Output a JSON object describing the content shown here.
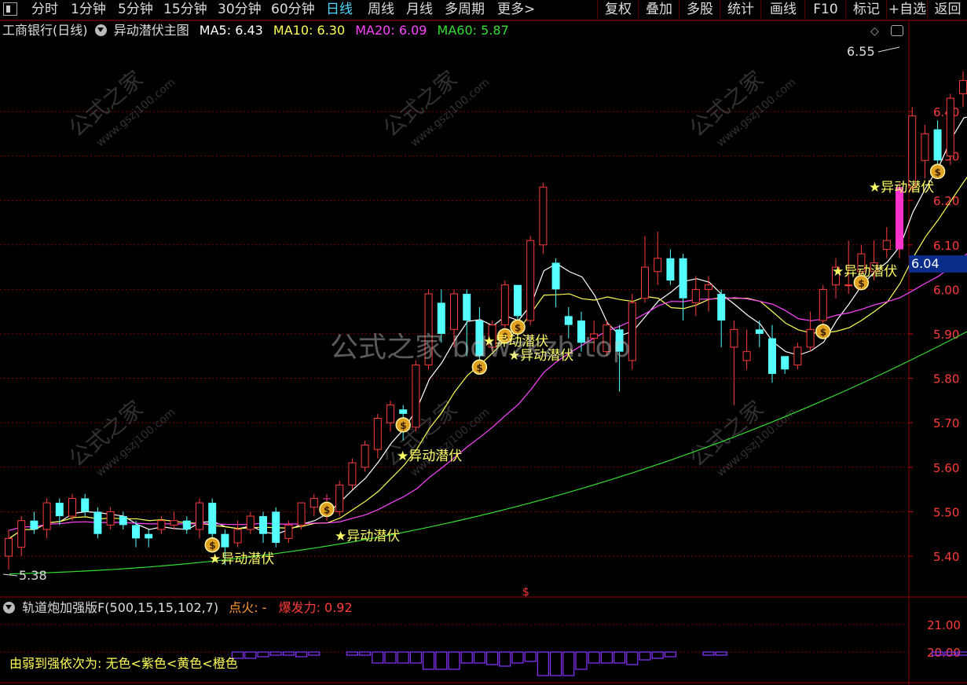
{
  "toolbar": {
    "periods": [
      "分时",
      "1分钟",
      "5分钟",
      "15分钟",
      "30分钟",
      "60分钟",
      "日线",
      "周线",
      "月线",
      "多周期",
      "更多>"
    ],
    "active_period": "日线",
    "right_buttons": [
      "复权",
      "叠加",
      "多股",
      "统计",
      "画线",
      "F10",
      "标记",
      "+自选",
      "返回"
    ]
  },
  "info": {
    "stock": "工商银行(日线)",
    "indicator": "异动潜伏主图",
    "ma5": "MA5: 6.43",
    "ma10": "MA10: 6.30",
    "ma20": "MA20: 6.09",
    "ma60": "MA60: 5.87"
  },
  "sub": {
    "indicator": "轨道炮加强版F(500,15,15,102,7)",
    "fire": "点火: -",
    "burst": "爆发力: 0.92",
    "legend": "由弱到强依次为: 无色<紫色<黄色<橙色"
  },
  "annotations": {
    "high_label": "6.55",
    "low_label": "5.38",
    "signal_text": "异动潜伏",
    "current_price": "6.04",
    "watermark": "公式之家",
    "watermark_url": "www.gszj100.com",
    "center_watermark": "公式之家 bdwzkzh.top"
  },
  "colors": {
    "up": "#ff3b3b",
    "down": "#54ffff",
    "ma5": "#ffffff",
    "ma10": "#ffff55",
    "ma20": "#ff44ff",
    "ma60": "#33dd33",
    "grid": "#7a0000",
    "signal_bar": "#ff33cc",
    "volume": "#8833ff"
  },
  "chart_data": {
    "type": "candlestick",
    "y_axis_ticks": [
      5.4,
      5.5,
      5.6,
      5.7,
      5.8,
      5.9,
      6.0,
      6.1,
      6.2,
      6.3,
      6.4
    ],
    "sub_axis_ticks": [
      20.0,
      21.0
    ],
    "candles": [
      [
        5.4,
        5.44,
        5.37,
        5.46
      ],
      [
        5.42,
        5.48,
        5.4,
        5.49
      ],
      [
        5.48,
        5.46,
        5.45,
        5.5
      ],
      [
        5.46,
        5.52,
        5.44,
        5.53
      ],
      [
        5.52,
        5.49,
        5.47,
        5.53
      ],
      [
        5.49,
        5.53,
        5.48,
        5.54
      ],
      [
        5.53,
        5.5,
        5.49,
        5.54
      ],
      [
        5.5,
        5.45,
        5.44,
        5.51
      ],
      [
        5.47,
        5.5,
        5.46,
        5.51
      ],
      [
        5.49,
        5.47,
        5.46,
        5.5
      ],
      [
        5.47,
        5.44,
        5.42,
        5.48
      ],
      [
        5.45,
        5.44,
        5.42,
        5.46
      ],
      [
        5.46,
        5.48,
        5.45,
        5.49
      ],
      [
        5.47,
        5.48,
        5.46,
        5.5
      ],
      [
        5.48,
        5.46,
        5.45,
        5.49
      ],
      [
        5.46,
        5.52,
        5.44,
        5.53
      ],
      [
        5.52,
        5.45,
        5.44,
        5.53
      ],
      [
        5.45,
        5.42,
        5.38,
        5.46
      ],
      [
        5.43,
        5.46,
        5.42,
        5.48
      ],
      [
        5.46,
        5.49,
        5.45,
        5.5
      ],
      [
        5.49,
        5.45,
        5.43,
        5.5
      ],
      [
        5.5,
        5.43,
        5.42,
        5.51
      ],
      [
        5.44,
        5.47,
        5.43,
        5.48
      ],
      [
        5.47,
        5.52,
        5.46,
        5.52
      ],
      [
        5.51,
        5.53,
        5.49,
        5.54
      ],
      [
        5.53,
        5.53,
        5.48,
        5.54
      ],
      [
        5.5,
        5.56,
        5.49,
        5.57
      ],
      [
        5.56,
        5.61,
        5.55,
        5.62
      ],
      [
        5.6,
        5.65,
        5.59,
        5.66
      ],
      [
        5.64,
        5.71,
        5.62,
        5.72
      ],
      [
        5.7,
        5.74,
        5.68,
        5.75
      ],
      [
        5.73,
        5.72,
        5.66,
        5.74
      ],
      [
        5.69,
        5.83,
        5.68,
        5.84
      ],
      [
        5.83,
        5.99,
        5.82,
        6.0
      ],
      [
        5.97,
        5.9,
        5.88,
        6.0
      ],
      [
        5.91,
        5.99,
        5.87,
        6.0
      ],
      [
        5.99,
        5.93,
        5.85,
        6.0
      ],
      [
        5.93,
        5.85,
        5.84,
        5.96
      ],
      [
        5.87,
        5.92,
        5.86,
        5.93
      ],
      [
        5.92,
        6.01,
        5.91,
        6.02
      ],
      [
        6.01,
        5.94,
        5.9,
        6.01
      ],
      [
        5.93,
        6.11,
        5.92,
        6.12
      ],
      [
        6.1,
        6.23,
        6.08,
        6.24
      ],
      [
        6.06,
        6.0,
        5.96,
        6.07
      ],
      [
        5.94,
        5.92,
        5.89,
        5.96
      ],
      [
        5.93,
        5.88,
        5.86,
        5.95
      ],
      [
        5.89,
        5.9,
        5.86,
        5.93
      ],
      [
        5.86,
        5.92,
        5.85,
        5.93
      ],
      [
        5.91,
        5.86,
        5.77,
        5.92
      ],
      [
        5.84,
        5.97,
        5.82,
        5.99
      ],
      [
        5.98,
        6.05,
        5.97,
        6.12
      ],
      [
        6.04,
        6.07,
        6.01,
        6.13
      ],
      [
        6.07,
        6.02,
        6.01,
        6.09
      ],
      [
        6.07,
        5.98,
        5.93,
        6.08
      ],
      [
        5.97,
        6.0,
        5.94,
        6.03
      ],
      [
        6.0,
        6.01,
        5.95,
        6.03
      ],
      [
        5.99,
        5.93,
        5.87,
        6.0
      ],
      [
        5.87,
        5.91,
        5.74,
        5.93
      ],
      [
        5.84,
        5.86,
        5.82,
        5.91
      ],
      [
        5.91,
        5.9,
        5.87,
        5.93
      ],
      [
        5.89,
        5.81,
        5.79,
        5.92
      ],
      [
        5.85,
        5.82,
        5.81,
        5.84
      ],
      [
        5.83,
        5.87,
        5.82,
        5.88
      ],
      [
        5.87,
        5.91,
        5.86,
        5.95
      ],
      [
        5.93,
        6.0,
        5.92,
        6.01
      ],
      [
        6.01,
        6.05,
        5.98,
        6.07
      ],
      [
        6.01,
        6.01,
        5.99,
        6.11
      ],
      [
        6.04,
        6.08,
        6.02,
        6.1
      ],
      [
        6.04,
        6.06,
        6.02,
        6.11
      ],
      [
        6.09,
        6.11,
        6.07,
        6.14
      ],
      [
        6.09,
        6.23,
        6.07,
        6.24
      ],
      [
        6.23,
        6.39,
        6.22,
        6.41
      ],
      [
        6.29,
        6.35,
        6.25,
        6.37
      ],
      [
        6.36,
        6.29,
        6.27,
        6.38
      ],
      [
        6.3,
        6.43,
        6.28,
        6.44
      ],
      [
        6.44,
        6.47,
        6.41,
        6.49
      ],
      [
        6.42,
        6.42,
        6.36,
        6.45
      ],
      [
        6.43,
        6.55,
        6.36,
        6.57
      ]
    ]
  }
}
